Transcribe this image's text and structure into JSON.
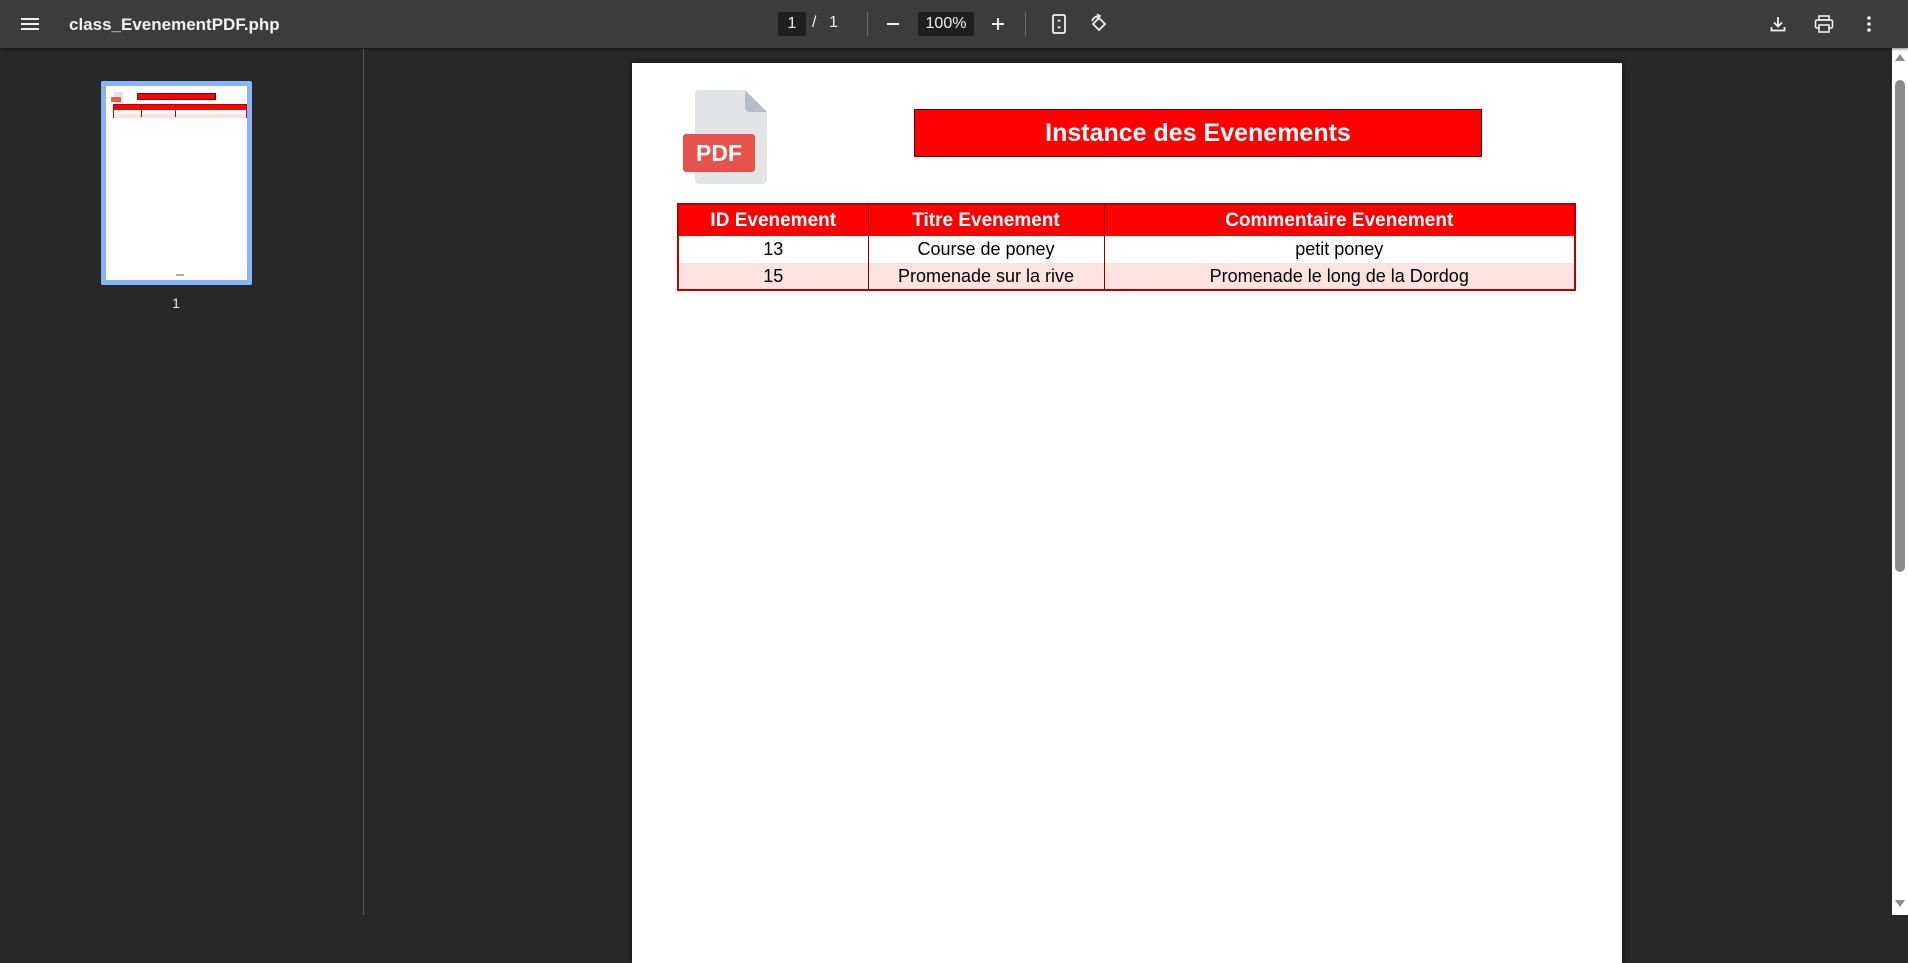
{
  "toolbar": {
    "menu_icon": "hamburger-menu-icon",
    "title": "class_EvenementPDF.php",
    "current_page": "1",
    "page_separator": "/",
    "total_pages": "1",
    "zoom": "100%",
    "icons": [
      "zoom-out-icon",
      "zoom-in-icon",
      "fit-to-page-icon",
      "rotate-icon",
      "download-icon",
      "print-icon",
      "more-options-icon"
    ]
  },
  "sidebar": {
    "thumbnails": [
      {
        "label": "1",
        "selected": true
      }
    ],
    "accent_color": "#8ab4f8"
  },
  "document": {
    "logo_text": "PDF",
    "heading": "Instance des Evenements",
    "heading_color": "#ff0000",
    "table": {
      "headers": [
        "ID Evenement",
        "Titre Evenement",
        "Commentaire Evenement"
      ],
      "rows": [
        [
          "13",
          "Course de poney",
          "petit poney"
        ],
        [
          "15",
          "Promenade sur la rive",
          "Promenade le long de la Dordog"
        ]
      ],
      "alt_row_color": "#fde2e2"
    }
  }
}
